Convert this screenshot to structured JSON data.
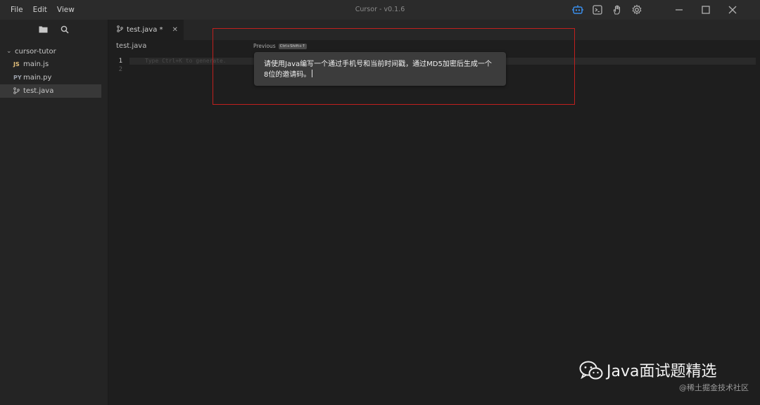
{
  "menu": [
    "File",
    "Edit",
    "View"
  ],
  "app_title": "Cursor - v0.1.6",
  "sidebar": {
    "folder": "cursor-tutor",
    "files": [
      {
        "badge": "JS",
        "name": "main.js"
      },
      {
        "badge": "PY",
        "name": "main.py"
      },
      {
        "badge": "",
        "name": "test.java"
      }
    ]
  },
  "tab": {
    "label": "test.java *"
  },
  "breadcrumb": "test.java",
  "editor": {
    "line_numbers": [
      "1",
      "2"
    ],
    "placeholder": "Type Ctrl+K to generate."
  },
  "prompt": {
    "previous_label": "Previous",
    "shortcut": "Ctrl+Shift+↑",
    "text": "请使用Java编写一个通过手机号和当前时间戳，通过MD5加密后生成一个8位的邀请码。"
  },
  "watermark": {
    "title": "Java面试题精选",
    "subtitle": "@稀土掘金技术社区"
  },
  "colors": {
    "highlight": "#c0201e",
    "accent": "#3b8eea"
  }
}
